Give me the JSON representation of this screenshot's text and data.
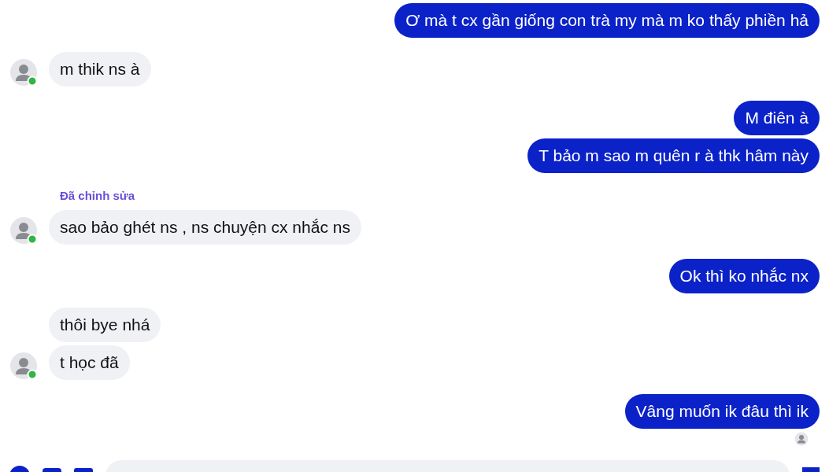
{
  "messages": [
    {
      "kind": "out",
      "text": "Ơ mà t cx gần giống con trà my mà m ko thấy phiền hả",
      "seen": false
    },
    {
      "kind": "in",
      "text": "m thik ns à",
      "seen": false
    },
    {
      "kind": "out",
      "text": "M điên à",
      "seen": false
    },
    {
      "kind": "out",
      "text": "T bảo m sao m quên r à thk hâm này",
      "seen": false
    },
    {
      "kind": "in",
      "text": "sao bảo ghét ns , ns chuyện cx nhắc ns",
      "edited_label": "Đã chỉnh sửa",
      "seen": false
    },
    {
      "kind": "out",
      "text": "Ok thì ko nhắc nx",
      "seen": false
    },
    {
      "kind": "in",
      "text": "thôi bye nhá",
      "seen": false
    },
    {
      "kind": "in",
      "text": "t học đã",
      "seen": false
    },
    {
      "kind": "out",
      "text": "Vâng muốn ik đâu thì ik",
      "seen": true
    }
  ]
}
